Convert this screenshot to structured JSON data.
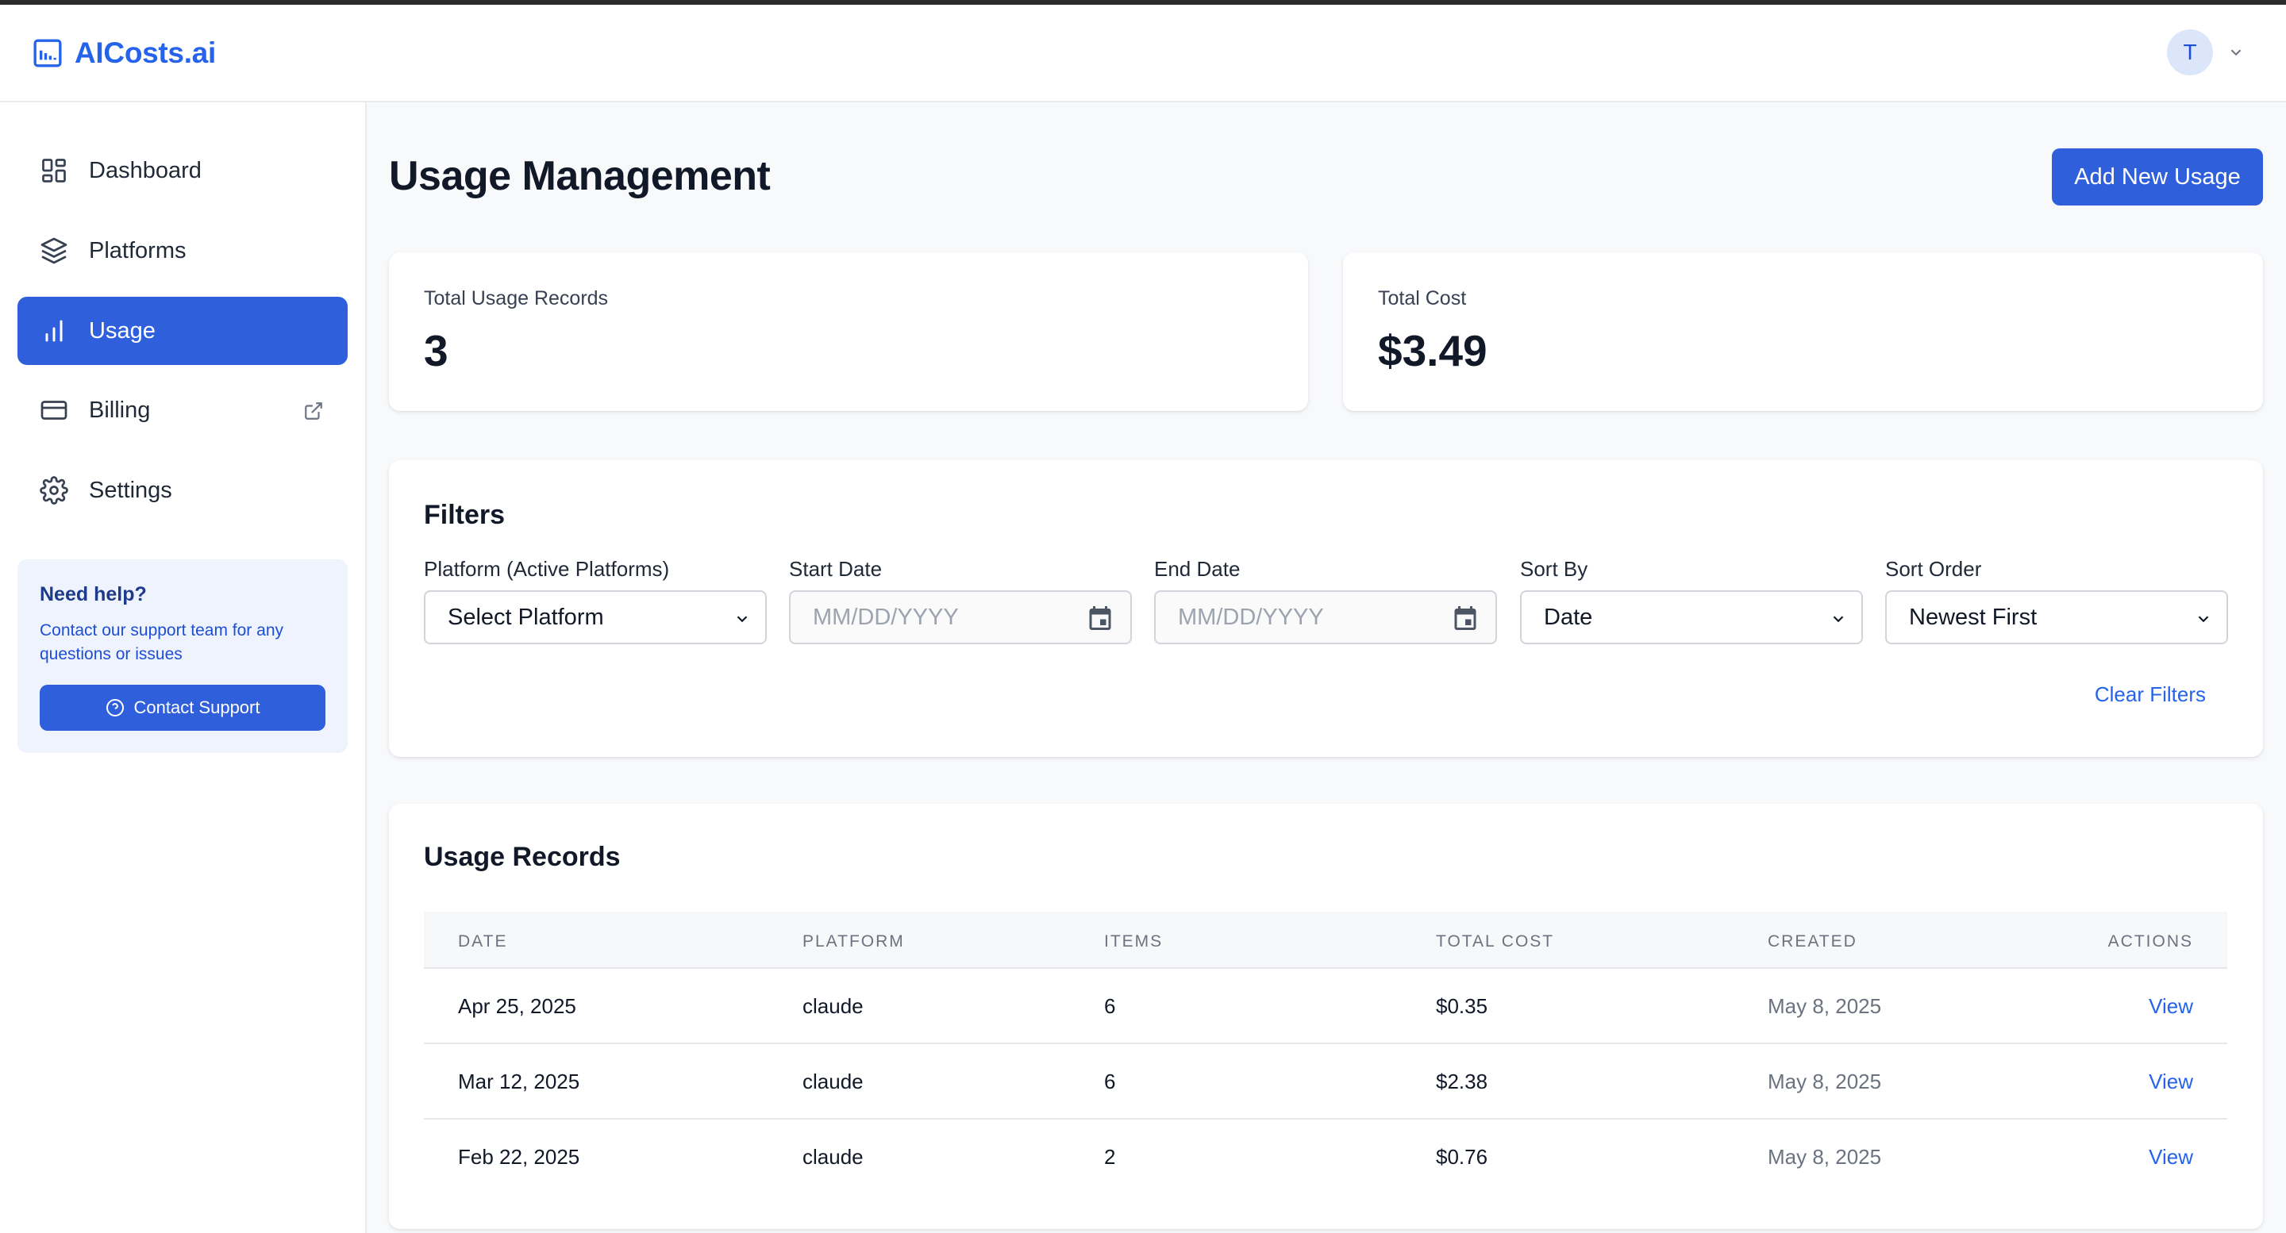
{
  "app": {
    "name": "AICosts.ai"
  },
  "user": {
    "initial": "T"
  },
  "sidebar": {
    "items": [
      {
        "label": "Dashboard",
        "icon": "grid-icon"
      },
      {
        "label": "Platforms",
        "icon": "layers-icon"
      },
      {
        "label": "Usage",
        "icon": "bar-chart-icon",
        "active": true
      },
      {
        "label": "Billing",
        "icon": "credit-card-icon",
        "external": true
      },
      {
        "label": "Settings",
        "icon": "gear-icon"
      }
    ],
    "help": {
      "title": "Need help?",
      "text": "Contact our support team for any questions or issues",
      "button": "Contact Support"
    }
  },
  "page": {
    "title": "Usage Management",
    "add_button": "Add New Usage"
  },
  "stats": {
    "total_records_label": "Total Usage Records",
    "total_records_value": "3",
    "total_cost_label": "Total Cost",
    "total_cost_value": "$3.49"
  },
  "filters": {
    "title": "Filters",
    "platform": {
      "label": "Platform (Active Platforms)",
      "value": "Select Platform"
    },
    "start_date": {
      "label": "Start Date",
      "placeholder": "MM/DD/YYYY"
    },
    "end_date": {
      "label": "End Date",
      "placeholder": "MM/DD/YYYY"
    },
    "sort_by": {
      "label": "Sort By",
      "value": "Date"
    },
    "sort_order": {
      "label": "Sort Order",
      "value": "Newest First"
    },
    "clear": "Clear Filters"
  },
  "records": {
    "title": "Usage Records",
    "columns": [
      "DATE",
      "PLATFORM",
      "ITEMS",
      "TOTAL COST",
      "CREATED",
      "ACTIONS"
    ],
    "rows": [
      {
        "date": "Apr 25, 2025",
        "platform": "claude",
        "items": "6",
        "total_cost": "$0.35",
        "created": "May 8, 2025",
        "action": "View"
      },
      {
        "date": "Mar 12, 2025",
        "platform": "claude",
        "items": "6",
        "total_cost": "$2.38",
        "created": "May 8, 2025",
        "action": "View"
      },
      {
        "date": "Feb 22, 2025",
        "platform": "claude",
        "items": "2",
        "total_cost": "$0.76",
        "created": "May 8, 2025",
        "action": "View"
      }
    ]
  },
  "colors": {
    "accent": "#2f5fdb",
    "link": "#2563eb",
    "help_bg": "#eef3fd"
  }
}
